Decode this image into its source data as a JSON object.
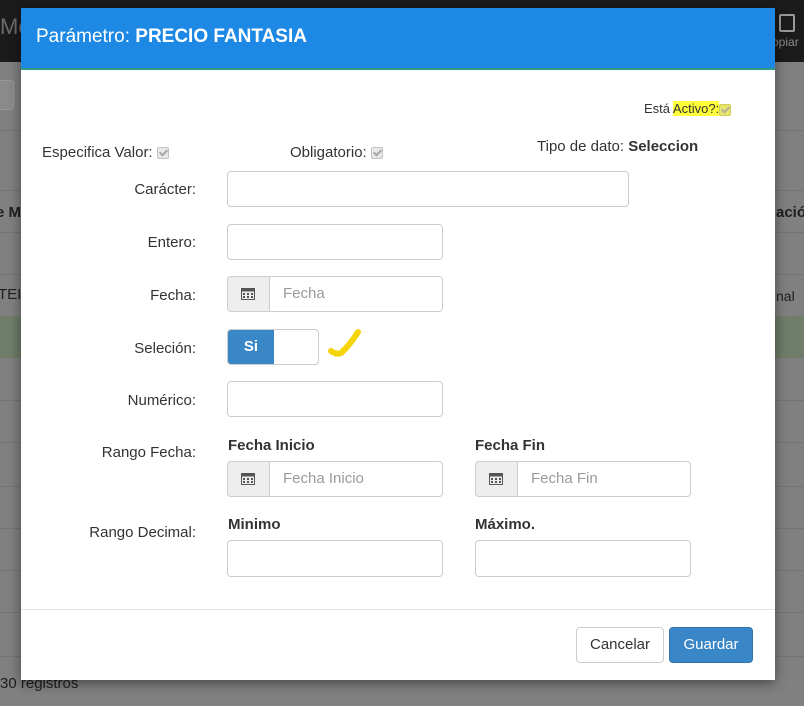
{
  "background": {
    "topbar_text": "Me",
    "copy_label": "opiar",
    "table_header_left": "e M",
    "table_header_right": "ació",
    "row_cell_left": "TEI",
    "row_cell_right": "nal",
    "records_text": "30 registros"
  },
  "modal": {
    "title_prefix": "Parámetro:",
    "title_name": "PRECIO FANTASIA",
    "active_label_prefix": "Está",
    "active_label_highlight": "Activo?:",
    "especifica_valor_label": "Especifica Valor:",
    "obligatorio_label": "Obligatorio:",
    "tipo_dato_label": "Tipo de dato:",
    "tipo_dato_value": "Seleccion",
    "fields": {
      "caracter_label": "Carácter:",
      "entero_label": "Entero:",
      "fecha_label": "Fecha:",
      "fecha_placeholder": "Fecha",
      "seleccion_label": "Seleción:",
      "seleccion_on_label": "Si",
      "numerico_label": "Numérico:",
      "rango_fecha_label": "Rango Fecha:",
      "fecha_inicio_title": "Fecha Inicio",
      "fecha_inicio_placeholder": "Fecha Inicio",
      "fecha_fin_title": "Fecha Fin",
      "fecha_fin_placeholder": "Fecha Fin",
      "rango_decimal_label": "Rango Decimal:",
      "minimo_title": "Minimo",
      "maximo_title": "Máximo."
    },
    "buttons": {
      "cancel": "Cancelar",
      "save": "Guardar"
    },
    "colors": {
      "header": "#1e88e5",
      "primary_button": "#3a87c8",
      "highlight": "#ffff3a"
    }
  }
}
